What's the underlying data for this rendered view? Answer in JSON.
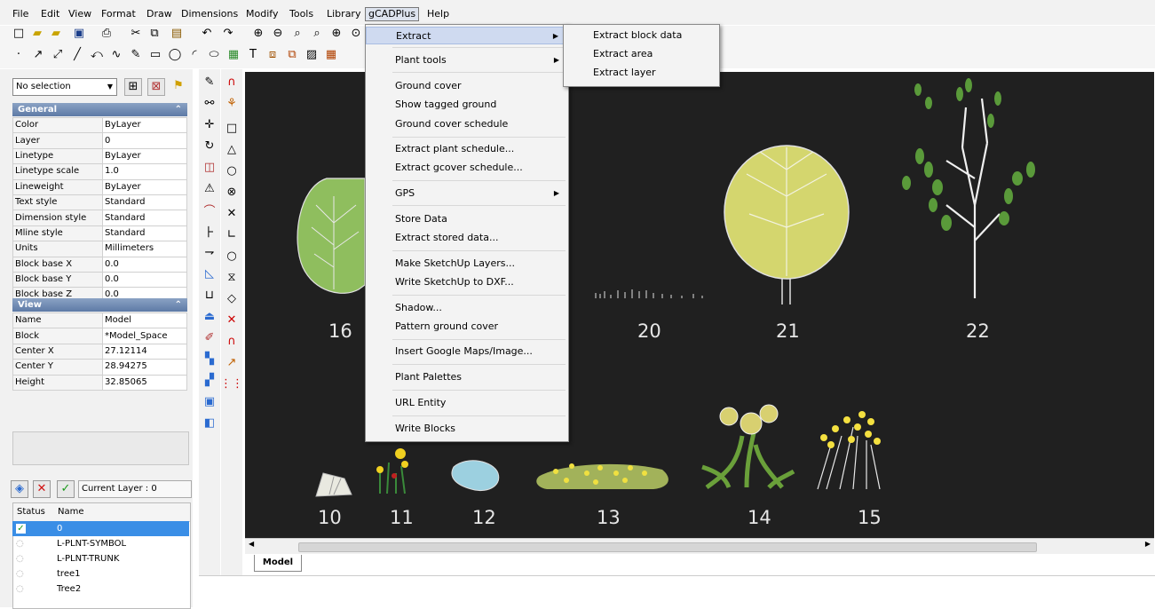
{
  "menubar": [
    "File",
    "Edit",
    "View",
    "Format",
    "Draw",
    "Dimensions",
    "Modify",
    "Tools",
    "Library",
    "gCADPlus",
    "Help"
  ],
  "properties": {
    "selection": "No selection",
    "general_title": "General",
    "general": [
      [
        "Color",
        "ByLayer"
      ],
      [
        "Layer",
        "0"
      ],
      [
        "Linetype",
        "ByLayer"
      ],
      [
        "Linetype scale",
        "1.0"
      ],
      [
        "Lineweight",
        "ByLayer"
      ],
      [
        "Text style",
        "Standard"
      ],
      [
        "Dimension style",
        "Standard"
      ],
      [
        "Mline style",
        "Standard"
      ],
      [
        "Units",
        "Millimeters"
      ],
      [
        "Block base X",
        "0.0"
      ],
      [
        "Block base Y",
        "0.0"
      ],
      [
        "Block base Z",
        "0.0"
      ]
    ],
    "view_title": "View",
    "view": [
      [
        "Name",
        "Model"
      ],
      [
        "Block",
        "*Model_Space"
      ],
      [
        "Center X",
        "27.12114"
      ],
      [
        "Center Y",
        "28.94275"
      ],
      [
        "Height",
        "32.85065"
      ]
    ]
  },
  "layers": {
    "current": "Current Layer : 0",
    "col_status": "Status",
    "col_name": "Name",
    "rows": [
      "0",
      "L-PLNT-SYMBOL",
      "L-PLNT-TRUNK",
      "tree1",
      "Tree2"
    ]
  },
  "gcad_menu": [
    {
      "label": "Extract",
      "arrow": true,
      "highlight": true
    },
    {
      "label": "Plant tools",
      "arrow": true
    },
    {
      "label": "Ground cover"
    },
    {
      "label": "Show tagged ground"
    },
    {
      "label": "Ground cover schedule"
    },
    {
      "label": "Extract plant schedule..."
    },
    {
      "label": "Extract gcover schedule..."
    },
    {
      "label": "GPS",
      "arrow": true
    },
    {
      "label": "Store Data"
    },
    {
      "label": "Extract stored data..."
    },
    {
      "label": "Make SketchUp Layers..."
    },
    {
      "label": "Write SketchUp to DXF..."
    },
    {
      "label": "Shadow..."
    },
    {
      "label": "Pattern ground cover"
    },
    {
      "label": "Insert Google Maps/Image..."
    },
    {
      "label": "Plant Palettes"
    },
    {
      "label": "URL Entity"
    },
    {
      "label": "Write Blocks"
    }
  ],
  "extract_submenu": [
    "Extract block data",
    "Extract area",
    "Extract layer"
  ],
  "canvas_labels": {
    "l16": "16",
    "l20": "20",
    "l21": "21",
    "l22": "22",
    "l10": "10",
    "l11": "11",
    "l12": "12",
    "l13": "13",
    "l14": "14",
    "l15": "15"
  },
  "layout_tab": "Model",
  "colors": {
    "canvas": "#202020",
    "menu_highlight": "#cfdaf0",
    "panel_header": "#6a86b0"
  }
}
